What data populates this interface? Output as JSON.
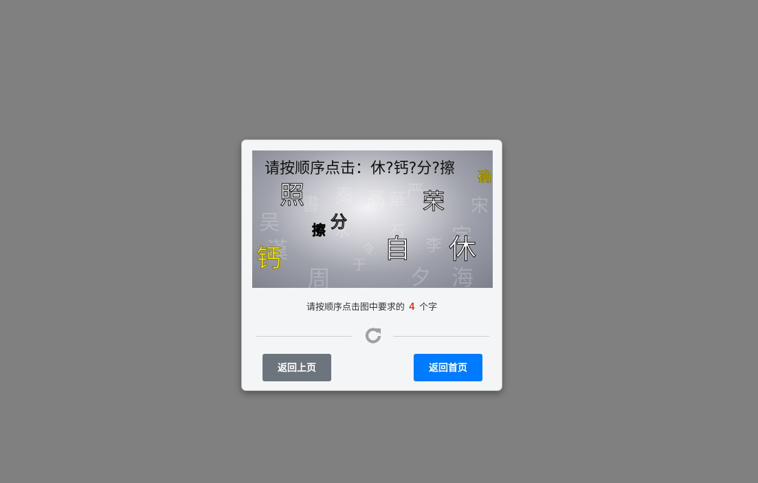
{
  "captcha": {
    "instruction": "请按顺序点击：休?钙?分?擦",
    "background_chars": [
      "書",
      "高",
      "華",
      "严",
      "秦",
      "李",
      "字",
      "令",
      "于",
      "周",
      "漢",
      "海",
      "夕",
      "吴",
      "宋",
      "水",
      "石"
    ],
    "targets": [
      {
        "char": "照",
        "style": "outline-dark"
      },
      {
        "char": "荣",
        "style": "outline-dark"
      },
      {
        "char": "分",
        "style": "solid-dark"
      },
      {
        "char": "擦",
        "style": "solid-dark"
      },
      {
        "char": "自",
        "style": "outline-dark"
      },
      {
        "char": "休",
        "style": "outline-dark"
      },
      {
        "char": "钙",
        "style": "outline-yellow"
      },
      {
        "char": "确",
        "style": "outline-yellow"
      }
    ]
  },
  "hint": {
    "prefix": "请按顺序点击图中要求的",
    "count": "4",
    "suffix": "个字"
  },
  "refresh": {
    "icon": "refresh-icon",
    "color": "#a0a0a0"
  },
  "buttons": {
    "back_label": "返回上页",
    "home_label": "返回首页"
  },
  "colors": {
    "overlay": "#808080",
    "back_button": "#6c757d",
    "home_button": "#007bff",
    "count_highlight": "#e60000"
  }
}
